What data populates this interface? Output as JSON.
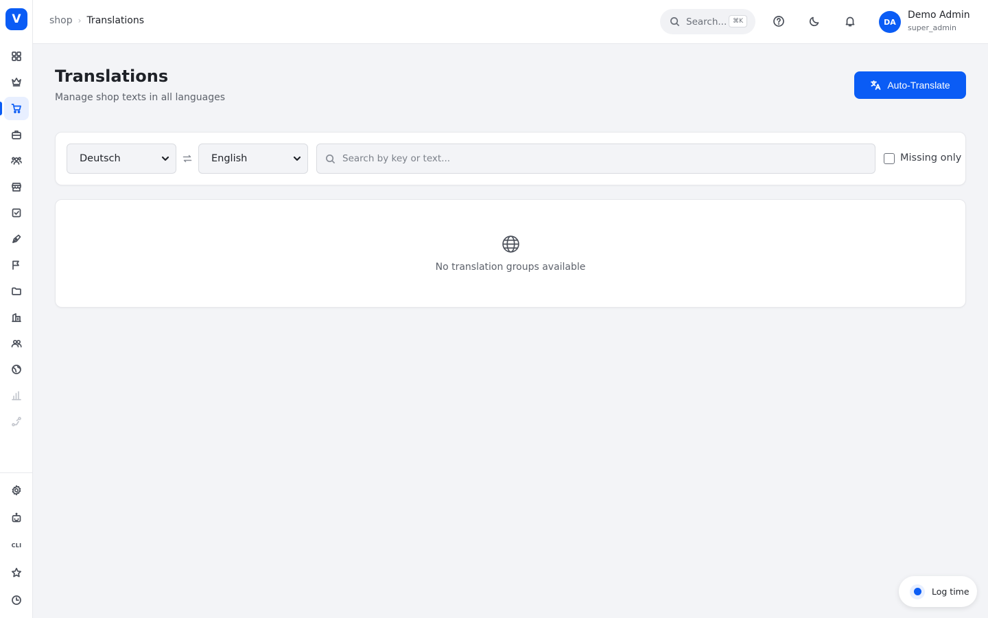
{
  "app": {
    "logo_letter": "V"
  },
  "breadcrumb": {
    "parent": "shop",
    "separator": "›",
    "current": "Translations"
  },
  "topbar": {
    "search_placeholder": "Search...",
    "search_shortcut": "⌘K",
    "icons": [
      "help-icon",
      "moon-icon",
      "bell-icon"
    ]
  },
  "user": {
    "initials": "DA",
    "name": "Demo Admin",
    "role": "super_admin"
  },
  "page": {
    "title": "Translations",
    "subtitle": "Manage shop texts in all languages",
    "auto_translate_label": "Auto-Translate"
  },
  "filters": {
    "source_language": "Deutsch",
    "target_language": "English",
    "search_placeholder": "Search by key or text...",
    "missing_only_label": "Missing only",
    "missing_only_checked": false
  },
  "empty_state": {
    "message": "No translation groups available"
  },
  "sidebar": {
    "items": [
      "dashboard-icon",
      "crown-icon",
      "cart-icon",
      "briefcase-icon",
      "users-icon",
      "store-icon",
      "checklist-icon",
      "pen-icon",
      "flag-icon",
      "folder-icon",
      "building-icon",
      "team-icon",
      "globe-icon",
      "chart-icon",
      "route-icon"
    ],
    "active": "cart-icon",
    "bottom_items": [
      "settings-icon",
      "robot-icon",
      "cli-icon",
      "star-icon",
      "clock-icon"
    ],
    "cli_label": "CLI"
  },
  "log_time": {
    "label": "Log time"
  },
  "colors": {
    "accent": "#0a5cf5",
    "background": "#f3f4f7"
  }
}
